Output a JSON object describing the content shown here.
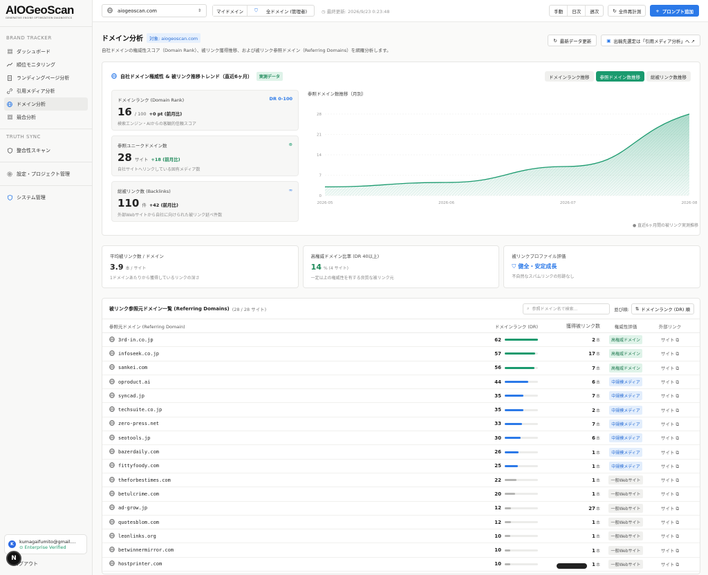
{
  "brand": {
    "name": "AIOGeoScan",
    "tagline": "GENERATIVE ENGINE OPTIMIZATION DIAGNOSTICS"
  },
  "sidebar": {
    "section_brand": "BRAND TRACKER",
    "items": [
      {
        "label": "ダッシュボード",
        "icon": "grid-icon"
      },
      {
        "label": "順位モニタリング",
        "icon": "trend-icon"
      },
      {
        "label": "ランディングページ分析",
        "icon": "page-icon"
      },
      {
        "label": "引用メディア分析",
        "icon": "link-icon"
      },
      {
        "label": "ドメイン分析",
        "icon": "globe-icon",
        "active": true
      },
      {
        "label": "競合分析",
        "icon": "grid-icon"
      }
    ],
    "section_truth": "TRUTH SYNC",
    "truth_items": [
      {
        "label": "整合性スキャン",
        "icon": "shield-icon"
      }
    ],
    "settings": {
      "label": "設定・プロジェクト管理",
      "icon": "gear-icon"
    },
    "system": {
      "label": "システム管理",
      "icon": "shield-icon"
    },
    "user": {
      "email": "kumagaifumito@gmail....",
      "plan": "Enterprise Verified",
      "initial": "K"
    },
    "logout": "ログアウト"
  },
  "topbar": {
    "domain": "aiogeoscan.com",
    "seg_my": "マイドメイン",
    "seg_all": "全ドメイン (管理者)",
    "updated": "最終更新: 2026/9/23 0:23:48",
    "period": [
      "手動",
      "日次",
      "週次"
    ],
    "rerun": "全件再計測",
    "add_prompt": "プロンプト追加"
  },
  "page": {
    "title": "ドメイン分析",
    "target": "対象: aiogeoscan.com",
    "desc": "自社ドメインの権威性スコア（Domain Rank）、被リンク獲得推移、および被リンク参照ドメイン（Referring Domains）を網羅分析します。",
    "refresh": "最新データ更新",
    "cited": "出稿先選定は「引用メディア分析」へ ↗"
  },
  "trend": {
    "title": "自社ドメイン権威性 & 被リンク推移トレンド（直近6ヶ月）",
    "badge": "実測データ",
    "tabs": [
      "ドメインランク推移",
      "参照ドメイン数推移",
      "総被リンク数推移"
    ],
    "active_tab": 1,
    "kpis": [
      {
        "label": "ドメインランク (Domain Rank)",
        "right": "DR 0-100",
        "value": "16",
        "unit": "/ 100",
        "delta": "+0 pt (前月比)",
        "note": "検索エンジン・AIからの客観的信頼スコア"
      },
      {
        "label": "参照ユニークドメイン数",
        "right_icon": "globe-icon",
        "value": "28",
        "unit": "サイト",
        "delta": "+18 (前月比)",
        "note": "自社サイトへリンクしている固有メディア数"
      },
      {
        "label": "総被リンク数 (Backlinks)",
        "right_icon": "link-icon",
        "value": "110",
        "unit": "件",
        "delta": "+42 (前月比)",
        "note": "外部Webサイトから自社に向けられた被リンク延べ件数"
      }
    ],
    "chart_title": "参照ドメイン数推移（月別）",
    "chart_foot": "● 直近6ヶ月間の被リンク実測推移"
  },
  "chart_data": {
    "type": "area",
    "title": "参照ドメイン数推移（月別）",
    "x": [
      "2026-05",
      "2026-06",
      "2026-07",
      "2026-08"
    ],
    "xlabel": "",
    "ylabel": "",
    "yticks": [
      0,
      7,
      14,
      21,
      28
    ],
    "ylim": [
      0,
      28
    ],
    "series": [
      {
        "values": [
          3,
          4.5,
          10,
          28
        ]
      }
    ],
    "color": "#1a9a6e"
  },
  "stats": [
    {
      "label": "平均被リンク数 / ドメイン",
      "value": "3.9",
      "unit": "本 / サイト",
      "note": "1ドメインあたりから獲得しているリンクの深さ"
    },
    {
      "label": "高権威ドメイン比率 (DR 40以上)",
      "value": "14",
      "unit": "% (4 サイト)",
      "note": "一定以上の権威性を有する良質な被リンク元"
    },
    {
      "label": "被リンクプロファイル評価",
      "value": "健全・安定成長",
      "note": "不自然なスパムリンクの形跡なし"
    }
  ],
  "table": {
    "title": "被リンク参照元ドメイン一覧 (Referring Domains)",
    "count": "(28 / 28 サイト)",
    "search_placeholder": "参照ドメイン名で検索...",
    "sort_label": "並び順:",
    "sort_value": "ドメインランク (DR) 順",
    "headers": [
      "参照元ドメイン (Referring Domain)",
      "ドメインランク (DR)",
      "獲得被リンク数",
      "権威性評価",
      "外部リンク"
    ],
    "link_unit": "本",
    "ext_label": "サイト",
    "rows": [
      {
        "domain": "3rd-in.co.jp",
        "dr": 62,
        "links": 2,
        "eval": "高権威ドメイン",
        "tier": "high"
      },
      {
        "domain": "infoseek.co.jp",
        "dr": 57,
        "links": 17,
        "eval": "高権威ドメイン",
        "tier": "high"
      },
      {
        "domain": "sankei.com",
        "dr": 56,
        "links": 7,
        "eval": "高権威ドメイン",
        "tier": "high"
      },
      {
        "domain": "oproduct.ai",
        "dr": 44,
        "links": 6,
        "eval": "中規模メディア",
        "tier": "mid"
      },
      {
        "domain": "syncad.jp",
        "dr": 35,
        "links": 7,
        "eval": "中規模メディア",
        "tier": "mid"
      },
      {
        "domain": "techsuite.co.jp",
        "dr": 35,
        "links": 2,
        "eval": "中規模メディア",
        "tier": "mid"
      },
      {
        "domain": "zero-press.net",
        "dr": 33,
        "links": 7,
        "eval": "中規模メディア",
        "tier": "mid"
      },
      {
        "domain": "seotools.jp",
        "dr": 30,
        "links": 6,
        "eval": "中規模メディア",
        "tier": "mid"
      },
      {
        "domain": "bazerdaily.com",
        "dr": 26,
        "links": 1,
        "eval": "中規模メディア",
        "tier": "mid"
      },
      {
        "domain": "fittyfoody.com",
        "dr": 25,
        "links": 1,
        "eval": "中規模メディア",
        "tier": "mid"
      },
      {
        "domain": "theforbestimes.com",
        "dr": 22,
        "links": 1,
        "eval": "一般Webサイト",
        "tier": "gen"
      },
      {
        "domain": "betulcrime.com",
        "dr": 20,
        "links": 1,
        "eval": "一般Webサイト",
        "tier": "gen"
      },
      {
        "domain": "ad-grow.jp",
        "dr": 12,
        "links": 27,
        "eval": "一般Webサイト",
        "tier": "gen"
      },
      {
        "domain": "quotesblom.com",
        "dr": 12,
        "links": 1,
        "eval": "一般Webサイト",
        "tier": "gen"
      },
      {
        "domain": "leonlinks.org",
        "dr": 10,
        "links": 1,
        "eval": "一般Webサイト",
        "tier": "gen"
      },
      {
        "domain": "betwinnermirror.com",
        "dr": 10,
        "links": 1,
        "eval": "一般Webサイト",
        "tier": "gen"
      },
      {
        "domain": "hostprinter.com",
        "dr": 10,
        "links": 1,
        "eval": "一般Webサイト",
        "tier": "gen"
      }
    ]
  },
  "colors": {
    "accent": "#2b79e8",
    "green": "#1a9a6e",
    "high_bar": "#1a9a6e",
    "mid_bar": "#2b79e8",
    "gen_bar": "#b5b5b3"
  }
}
